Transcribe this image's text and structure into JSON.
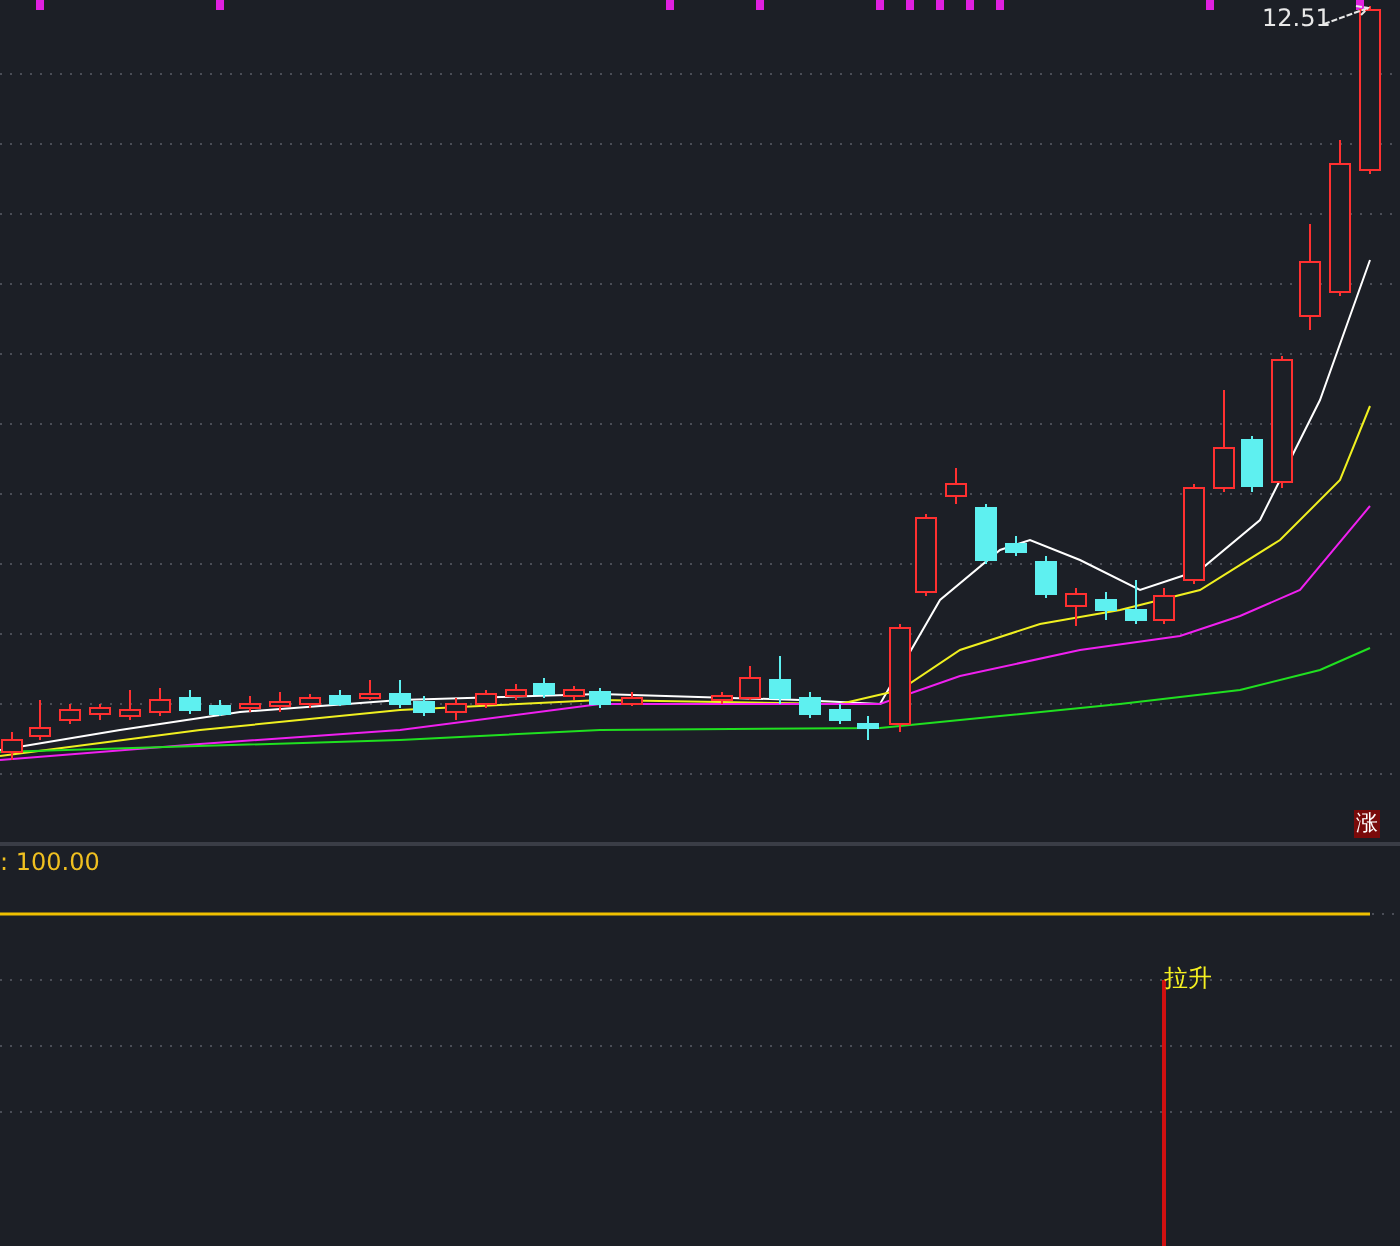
{
  "main_chart": {
    "last_price": "12.51",
    "badge": "涨"
  },
  "indicator": {
    "value_label": ": 100.00",
    "signal_label": "拉升"
  }
}
